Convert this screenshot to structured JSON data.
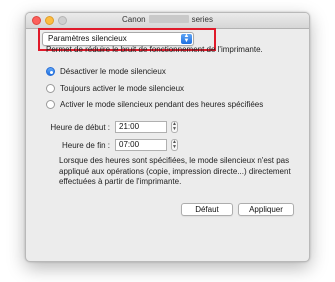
{
  "window": {
    "title_prefix": "Canon",
    "title_suffix": "series"
  },
  "popup": {
    "selected": "Paramètres silencieux"
  },
  "description": "Permet de réduire le bruit de fonctionnement de l'imprimante.",
  "options": [
    {
      "label": "Désactiver le mode silencieux",
      "checked": true
    },
    {
      "label": "Toujours activer le mode silencieux",
      "checked": false
    },
    {
      "label": "Activer le mode silencieux pendant des heures spécifiées",
      "checked": false
    }
  ],
  "start_time": {
    "label": "Heure de début :",
    "value": "21:00"
  },
  "end_time": {
    "label": "Heure de fin :",
    "value": "07:00"
  },
  "note": "Lorsque des heures sont spécifiées, le mode silencieux n'est pas appliqué aux opérations (copie, impression directe...) directement effectuées à partir de l'imprimante.",
  "buttons": {
    "default": "Défaut",
    "apply": "Appliquer"
  },
  "colors": {
    "highlight": "#e01a2a",
    "accent": "#1e6fe0"
  }
}
